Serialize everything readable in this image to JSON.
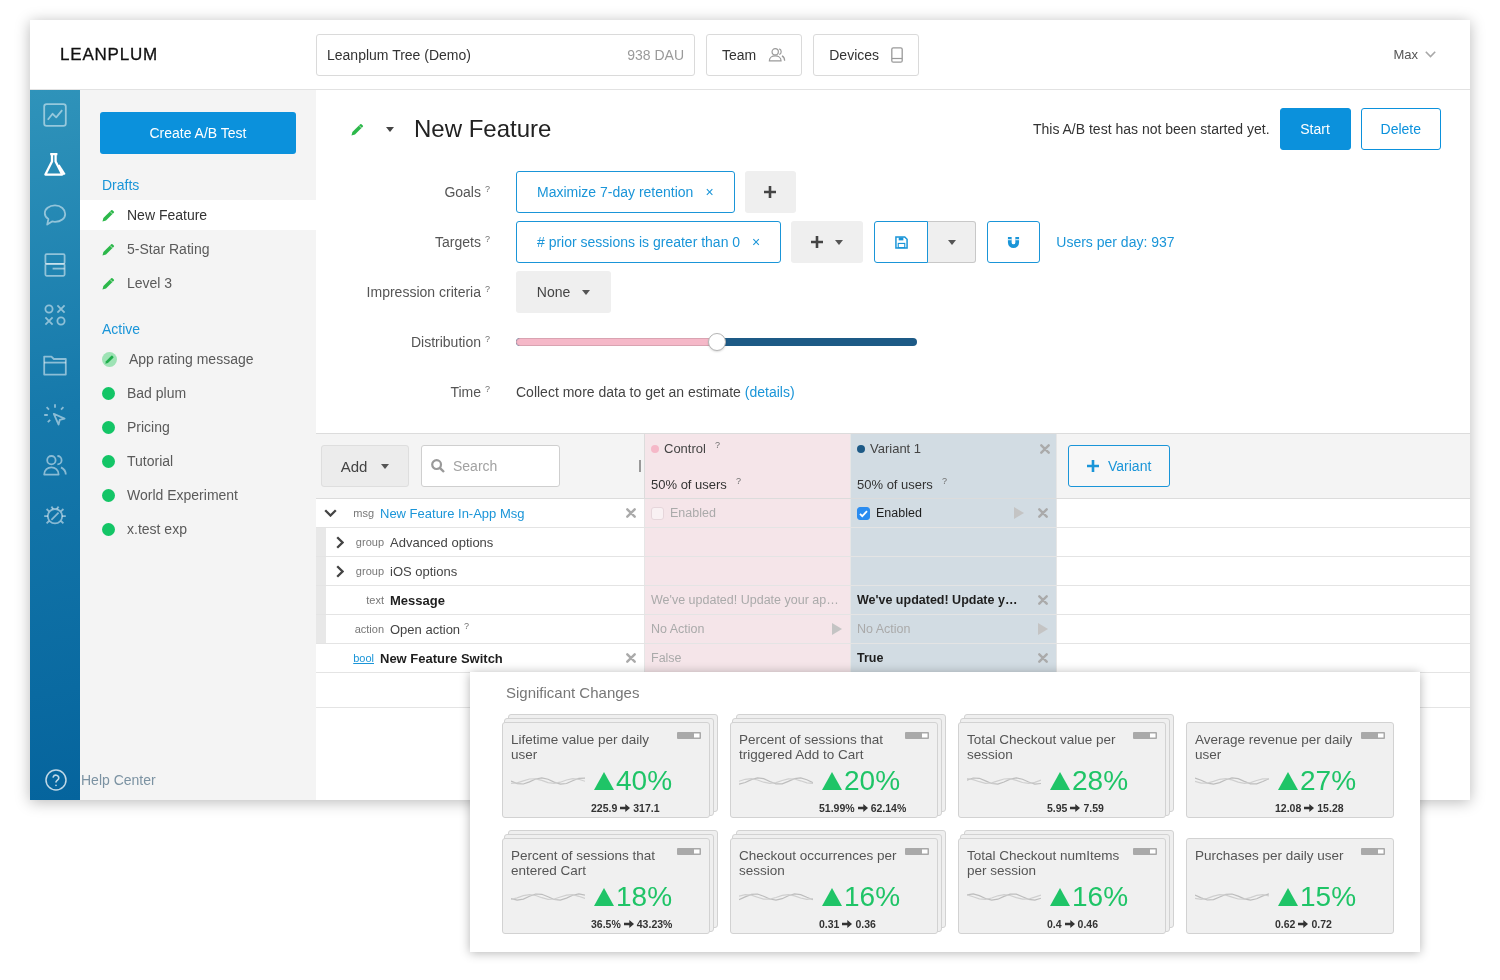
{
  "header": {
    "logo": "LEANPLUM",
    "app_selector": {
      "name": "Leanplum Tree (Demo)",
      "dau": "938 DAU"
    },
    "buttons": [
      {
        "label": "Team"
      },
      {
        "label": "Devices"
      }
    ],
    "user": "Max"
  },
  "nav_rail": {
    "items": [
      {
        "selected": false
      },
      {
        "selected": true
      },
      {
        "selected": false
      },
      {
        "selected": false
      },
      {
        "selected": false
      },
      {
        "selected": false
      },
      {
        "selected": false
      },
      {
        "selected": false
      },
      {
        "selected": false
      }
    ],
    "help": "Help Center"
  },
  "sidebar": {
    "create_button": "Create A/B Test",
    "sections": [
      {
        "title": "Drafts",
        "items": [
          {
            "label": "New Feature",
            "kind": "draft",
            "selected": true
          },
          {
            "label": "5-Star Rating",
            "kind": "draft",
            "selected": false
          },
          {
            "label": "Level 3",
            "kind": "draft",
            "selected": false
          }
        ]
      },
      {
        "title": "Active",
        "items": [
          {
            "label": "App rating message",
            "kind": "edited",
            "selected": false
          },
          {
            "label": "Bad plum",
            "kind": "running",
            "selected": false
          },
          {
            "label": "Pricing",
            "kind": "running",
            "selected": false
          },
          {
            "label": "Tutorial",
            "kind": "running",
            "selected": false
          },
          {
            "label": "World Experiment",
            "kind": "running",
            "selected": false
          },
          {
            "label": "x.test exp",
            "kind": "running",
            "selected": false
          }
        ]
      }
    ]
  },
  "test": {
    "title": "New Feature",
    "status": "This A/B test has not been started yet.",
    "actions": [
      {
        "label": "Start",
        "kind": "primary"
      },
      {
        "label": "Delete",
        "kind": "secondary"
      }
    ],
    "form": {
      "goals": {
        "label": "Goals",
        "help": "?",
        "chips": [
          {
            "label": "Maximize 7-day retention",
            "remove": "×"
          }
        ]
      },
      "targets": {
        "label": "Targets",
        "help": "?",
        "chips": [
          {
            "label": "# prior sessions is greater than 0",
            "remove": "×"
          }
        ],
        "users_per_day": "Users per day: 937"
      },
      "impression_criteria": {
        "label": "Impression criteria",
        "help": "?",
        "value": "None"
      },
      "distribution": {
        "label": "Distribution",
        "help": "?",
        "level": 0.5
      },
      "time": {
        "label": "Time",
        "help": "?",
        "text": "Collect more data to get an estimate",
        "link": "(details)"
      }
    }
  },
  "variants_table": {
    "toolbar": {
      "add": "Add",
      "search_placeholder": "Search"
    },
    "variants": [
      {
        "name": "Control",
        "help": "?",
        "share": "50% of users",
        "share_help": "?",
        "color": "#f5b8c8",
        "removable": false
      },
      {
        "name": "Variant 1",
        "share": "50% of users",
        "share_help": "?",
        "color": "#1d5a86",
        "removable": true
      }
    ],
    "add_variant": "Variant",
    "rows": [
      {
        "kind": "message",
        "type": "msg",
        "name": "New Feature In-App Msg",
        "expanded": true,
        "cells": [
          {
            "kind": "toggle",
            "label": "Enabled",
            "checked": false,
            "disabled": true,
            "overridden": false
          },
          {
            "kind": "toggle",
            "label": "Enabled",
            "checked": true,
            "disabled": false,
            "overridden": true
          }
        ],
        "children": [
          {
            "kind": "group",
            "type": "group",
            "name": "Advanced options",
            "expanded": false
          },
          {
            "kind": "group",
            "type": "group",
            "name": "iOS options",
            "expanded": false
          },
          {
            "kind": "field",
            "type": "text",
            "name": "Message",
            "cells": [
              {
                "kind": "text",
                "value": "We've updated! Update your ap…",
                "overridden": false
              },
              {
                "kind": "text",
                "value": "We've updated! Update y…",
                "overridden": true
              }
            ]
          },
          {
            "kind": "action",
            "type": "action",
            "name": "Open action",
            "help": "?",
            "cells": [
              {
                "kind": "action",
                "value": "No Action",
                "overridden": false
              },
              {
                "kind": "action",
                "value": "No Action",
                "overridden": false
              }
            ]
          }
        ]
      },
      {
        "kind": "variable",
        "type": "bool",
        "name": "New Feature Switch",
        "cells": [
          {
            "kind": "text",
            "value": "False",
            "overridden": false
          },
          {
            "kind": "text",
            "value": "True",
            "overridden": true
          }
        ]
      }
    ]
  },
  "significant_changes": {
    "title": "Significant Changes",
    "cards": [
      {
        "title": "Lifetime value per daily user",
        "increased": true,
        "change": "40%",
        "from": "225.9",
        "to": "317.1",
        "kind": "stack"
      },
      {
        "title": "Percent of sessions that triggered Add to Cart",
        "increased": true,
        "change": "20%",
        "from": "51.99%",
        "to": "62.14%",
        "kind": "stack"
      },
      {
        "title": "Total Checkout value per session",
        "increased": true,
        "change": "28%",
        "from": "5.95",
        "to": "7.59",
        "kind": "stack"
      },
      {
        "title": "Average revenue per daily user",
        "increased": true,
        "change": "27%",
        "from": "12.08",
        "to": "15.28",
        "kind": "single"
      },
      {
        "title": "Percent of sessions that entered Cart",
        "increased": true,
        "change": "18%",
        "from": "36.5%",
        "to": "43.23%",
        "kind": "stack"
      },
      {
        "title": "Checkout occurrences per session",
        "increased": true,
        "change": "16%",
        "from": "0.31",
        "to": "0.36",
        "kind": "stack"
      },
      {
        "title": "Total Checkout numItems per session",
        "increased": true,
        "change": "16%",
        "from": "0.4",
        "to": "0.46",
        "kind": "stack"
      },
      {
        "title": "Purchases per daily user",
        "increased": true,
        "change": "15%",
        "from": "0.62",
        "to": "0.72",
        "kind": "single"
      }
    ]
  }
}
